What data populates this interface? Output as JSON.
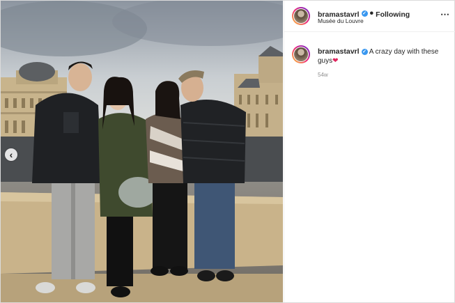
{
  "post": {
    "username": "bramastavrl",
    "follow_status": "Following",
    "separator": "•",
    "location": "Musée du Louvre",
    "more_icon": "⋯",
    "caption_text": "A crazy day with these guys",
    "caption_emoji": "❤",
    "time_ago": "54w",
    "verified_icon": "✓"
  },
  "photo": {
    "prev_icon": "‹"
  },
  "colors": {
    "verified": "#3897f0",
    "text": "#262626",
    "muted": "#8e8e8e",
    "border": "#dbdbdb"
  }
}
